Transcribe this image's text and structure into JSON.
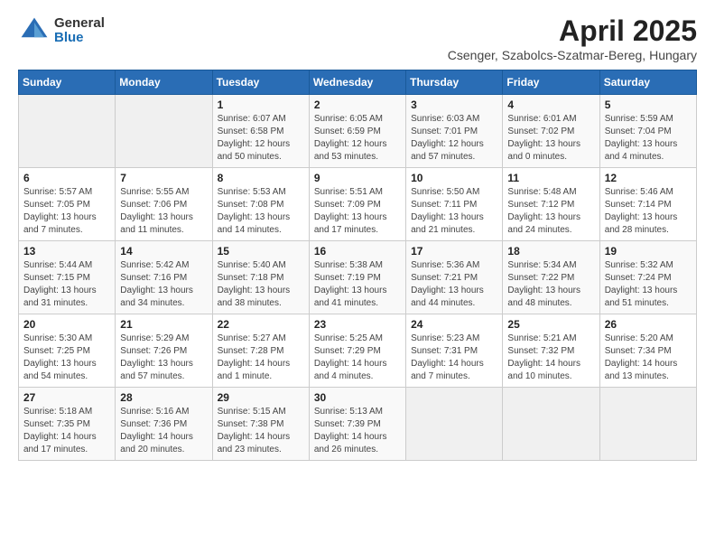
{
  "logo": {
    "general": "General",
    "blue": "Blue"
  },
  "header": {
    "month_year": "April 2025",
    "location": "Csenger, Szabolcs-Szatmar-Bereg, Hungary"
  },
  "weekdays": [
    "Sunday",
    "Monday",
    "Tuesday",
    "Wednesday",
    "Thursday",
    "Friday",
    "Saturday"
  ],
  "weeks": [
    [
      {
        "day": "",
        "sunrise": "",
        "sunset": "",
        "daylight": ""
      },
      {
        "day": "",
        "sunrise": "",
        "sunset": "",
        "daylight": ""
      },
      {
        "day": "1",
        "sunrise": "Sunrise: 6:07 AM",
        "sunset": "Sunset: 6:58 PM",
        "daylight": "Daylight: 12 hours and 50 minutes."
      },
      {
        "day": "2",
        "sunrise": "Sunrise: 6:05 AM",
        "sunset": "Sunset: 6:59 PM",
        "daylight": "Daylight: 12 hours and 53 minutes."
      },
      {
        "day": "3",
        "sunrise": "Sunrise: 6:03 AM",
        "sunset": "Sunset: 7:01 PM",
        "daylight": "Daylight: 12 hours and 57 minutes."
      },
      {
        "day": "4",
        "sunrise": "Sunrise: 6:01 AM",
        "sunset": "Sunset: 7:02 PM",
        "daylight": "Daylight: 13 hours and 0 minutes."
      },
      {
        "day": "5",
        "sunrise": "Sunrise: 5:59 AM",
        "sunset": "Sunset: 7:04 PM",
        "daylight": "Daylight: 13 hours and 4 minutes."
      }
    ],
    [
      {
        "day": "6",
        "sunrise": "Sunrise: 5:57 AM",
        "sunset": "Sunset: 7:05 PM",
        "daylight": "Daylight: 13 hours and 7 minutes."
      },
      {
        "day": "7",
        "sunrise": "Sunrise: 5:55 AM",
        "sunset": "Sunset: 7:06 PM",
        "daylight": "Daylight: 13 hours and 11 minutes."
      },
      {
        "day": "8",
        "sunrise": "Sunrise: 5:53 AM",
        "sunset": "Sunset: 7:08 PM",
        "daylight": "Daylight: 13 hours and 14 minutes."
      },
      {
        "day": "9",
        "sunrise": "Sunrise: 5:51 AM",
        "sunset": "Sunset: 7:09 PM",
        "daylight": "Daylight: 13 hours and 17 minutes."
      },
      {
        "day": "10",
        "sunrise": "Sunrise: 5:50 AM",
        "sunset": "Sunset: 7:11 PM",
        "daylight": "Daylight: 13 hours and 21 minutes."
      },
      {
        "day": "11",
        "sunrise": "Sunrise: 5:48 AM",
        "sunset": "Sunset: 7:12 PM",
        "daylight": "Daylight: 13 hours and 24 minutes."
      },
      {
        "day": "12",
        "sunrise": "Sunrise: 5:46 AM",
        "sunset": "Sunset: 7:14 PM",
        "daylight": "Daylight: 13 hours and 28 minutes."
      }
    ],
    [
      {
        "day": "13",
        "sunrise": "Sunrise: 5:44 AM",
        "sunset": "Sunset: 7:15 PM",
        "daylight": "Daylight: 13 hours and 31 minutes."
      },
      {
        "day": "14",
        "sunrise": "Sunrise: 5:42 AM",
        "sunset": "Sunset: 7:16 PM",
        "daylight": "Daylight: 13 hours and 34 minutes."
      },
      {
        "day": "15",
        "sunrise": "Sunrise: 5:40 AM",
        "sunset": "Sunset: 7:18 PM",
        "daylight": "Daylight: 13 hours and 38 minutes."
      },
      {
        "day": "16",
        "sunrise": "Sunrise: 5:38 AM",
        "sunset": "Sunset: 7:19 PM",
        "daylight": "Daylight: 13 hours and 41 minutes."
      },
      {
        "day": "17",
        "sunrise": "Sunrise: 5:36 AM",
        "sunset": "Sunset: 7:21 PM",
        "daylight": "Daylight: 13 hours and 44 minutes."
      },
      {
        "day": "18",
        "sunrise": "Sunrise: 5:34 AM",
        "sunset": "Sunset: 7:22 PM",
        "daylight": "Daylight: 13 hours and 48 minutes."
      },
      {
        "day": "19",
        "sunrise": "Sunrise: 5:32 AM",
        "sunset": "Sunset: 7:24 PM",
        "daylight": "Daylight: 13 hours and 51 minutes."
      }
    ],
    [
      {
        "day": "20",
        "sunrise": "Sunrise: 5:30 AM",
        "sunset": "Sunset: 7:25 PM",
        "daylight": "Daylight: 13 hours and 54 minutes."
      },
      {
        "day": "21",
        "sunrise": "Sunrise: 5:29 AM",
        "sunset": "Sunset: 7:26 PM",
        "daylight": "Daylight: 13 hours and 57 minutes."
      },
      {
        "day": "22",
        "sunrise": "Sunrise: 5:27 AM",
        "sunset": "Sunset: 7:28 PM",
        "daylight": "Daylight: 14 hours and 1 minute."
      },
      {
        "day": "23",
        "sunrise": "Sunrise: 5:25 AM",
        "sunset": "Sunset: 7:29 PM",
        "daylight": "Daylight: 14 hours and 4 minutes."
      },
      {
        "day": "24",
        "sunrise": "Sunrise: 5:23 AM",
        "sunset": "Sunset: 7:31 PM",
        "daylight": "Daylight: 14 hours and 7 minutes."
      },
      {
        "day": "25",
        "sunrise": "Sunrise: 5:21 AM",
        "sunset": "Sunset: 7:32 PM",
        "daylight": "Daylight: 14 hours and 10 minutes."
      },
      {
        "day": "26",
        "sunrise": "Sunrise: 5:20 AM",
        "sunset": "Sunset: 7:34 PM",
        "daylight": "Daylight: 14 hours and 13 minutes."
      }
    ],
    [
      {
        "day": "27",
        "sunrise": "Sunrise: 5:18 AM",
        "sunset": "Sunset: 7:35 PM",
        "daylight": "Daylight: 14 hours and 17 minutes."
      },
      {
        "day": "28",
        "sunrise": "Sunrise: 5:16 AM",
        "sunset": "Sunset: 7:36 PM",
        "daylight": "Daylight: 14 hours and 20 minutes."
      },
      {
        "day": "29",
        "sunrise": "Sunrise: 5:15 AM",
        "sunset": "Sunset: 7:38 PM",
        "daylight": "Daylight: 14 hours and 23 minutes."
      },
      {
        "day": "30",
        "sunrise": "Sunrise: 5:13 AM",
        "sunset": "Sunset: 7:39 PM",
        "daylight": "Daylight: 14 hours and 26 minutes."
      },
      {
        "day": "",
        "sunrise": "",
        "sunset": "",
        "daylight": ""
      },
      {
        "day": "",
        "sunrise": "",
        "sunset": "",
        "daylight": ""
      },
      {
        "day": "",
        "sunrise": "",
        "sunset": "",
        "daylight": ""
      }
    ]
  ]
}
